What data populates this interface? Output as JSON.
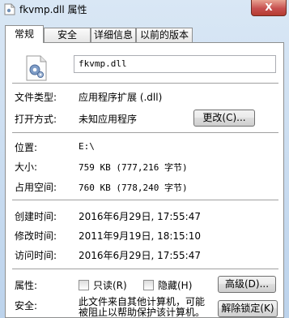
{
  "window": {
    "title": "fkvmp.dll 属性",
    "close_glyph": "X"
  },
  "tabs": [
    {
      "label": "常规"
    },
    {
      "label": "安全"
    },
    {
      "label": "详细信息"
    },
    {
      "label": "以前的版本"
    }
  ],
  "general": {
    "file_name": "fkvmp.dll",
    "file_type_label": "文件类型:",
    "file_type_value": "应用程序扩展 (.dll)",
    "opens_with_label": "打开方式:",
    "opens_with_value": "未知应用程序",
    "change_button": "更改(C)...",
    "location_label": "位置:",
    "location_value": "E:\\",
    "size_label": "大小:",
    "size_value": "759 KB (777,216 字节)",
    "size_on_disk_label": "占用空间:",
    "size_on_disk_value": "760 KB (778,240 字节)",
    "created_label": "创建时间:",
    "created_value": "2016年6月29日, 17:55:47",
    "modified_label": "修改时间:",
    "modified_value": "2011年9月19日, 18:15:10",
    "accessed_label": "访问时间:",
    "accessed_value": "2016年6月29日, 17:55:47",
    "attributes_label": "属性:",
    "readonly_label": "只读(R)",
    "readonly_checked": false,
    "hidden_label": "隐藏(H)",
    "hidden_checked": false,
    "advanced_button": "高级(D)...",
    "security_label": "安全:",
    "security_text_1": "此文件来自其他计算机，可能",
    "security_text_2": "被阻止以帮助保护该计算机。",
    "unblock_button": "解除锁定(K)"
  },
  "colors": {
    "title_bg": "#c9dcf0",
    "close_button": "#c75050",
    "panel_bg": "#ffffff"
  }
}
